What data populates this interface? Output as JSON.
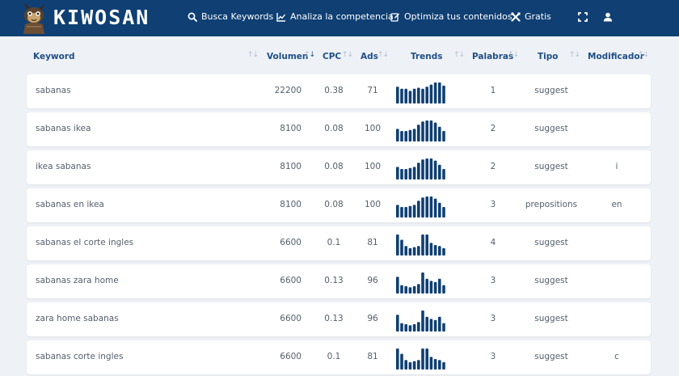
{
  "brand": "KIWOSAN",
  "nav": [
    {
      "label": "Busca Keywords",
      "icon": "search-icon"
    },
    {
      "label": "Analiza la competencia",
      "icon": "chart-line-icon"
    },
    {
      "label": "Optimiza tus contenidos",
      "icon": "edit-icon"
    },
    {
      "label": "Gratis",
      "icon": "tools-icon"
    }
  ],
  "columns": [
    "Keyword",
    "Volumen",
    "CPC",
    "Ads",
    "Trends",
    "Palabras",
    "Tipo",
    "Modificador"
  ],
  "sorted_column": "Volumen",
  "colors": {
    "topbar": "#0f3f73",
    "accent": "#1e4f86",
    "bars": "#0f3f73",
    "background": "#eef1f6"
  },
  "rows": [
    {
      "keyword": "sabanas",
      "volumen": "22200",
      "cpc": "0.38",
      "ads": "71",
      "palabras": "1",
      "tipo": "suggest",
      "modificador": "",
      "trend": [
        0.8,
        0.7,
        0.7,
        0.6,
        0.7,
        0.75,
        0.7,
        0.8,
        0.9,
        1.0,
        1.0,
        0.85
      ]
    },
    {
      "keyword": "sabanas ikea",
      "volumen": "8100",
      "cpc": "0.08",
      "ads": "100",
      "palabras": "2",
      "tipo": "suggest",
      "modificador": "",
      "trend": [
        0.6,
        0.5,
        0.5,
        0.55,
        0.6,
        0.8,
        0.95,
        1.0,
        1.0,
        0.9,
        0.7,
        0.5
      ]
    },
    {
      "keyword": "ikea sabanas",
      "volumen": "8100",
      "cpc": "0.08",
      "ads": "100",
      "palabras": "2",
      "tipo": "suggest",
      "modificador": "i",
      "trend": [
        0.6,
        0.5,
        0.5,
        0.55,
        0.6,
        0.8,
        0.95,
        1.0,
        1.0,
        0.9,
        0.7,
        0.5
      ]
    },
    {
      "keyword": "sabanas en ikea",
      "volumen": "8100",
      "cpc": "0.08",
      "ads": "100",
      "palabras": "3",
      "tipo": "prepositions",
      "modificador": "en",
      "trend": [
        0.6,
        0.5,
        0.5,
        0.55,
        0.6,
        0.8,
        0.95,
        1.0,
        1.0,
        0.9,
        0.7,
        0.5
      ]
    },
    {
      "keyword": "sabanas el corte ingles",
      "volumen": "6600",
      "cpc": "0.1",
      "ads": "81",
      "palabras": "4",
      "tipo": "suggest",
      "modificador": "",
      "trend": [
        1.0,
        0.75,
        0.45,
        0.35,
        0.4,
        0.45,
        1.0,
        1.0,
        0.6,
        0.5,
        0.45,
        0.35
      ]
    },
    {
      "keyword": "sabanas zara home",
      "volumen": "6600",
      "cpc": "0.13",
      "ads": "96",
      "palabras": "3",
      "tipo": "suggest",
      "modificador": "",
      "trend": [
        0.8,
        0.4,
        0.35,
        0.3,
        0.35,
        0.45,
        1.0,
        0.7,
        0.6,
        0.55,
        0.7,
        0.4
      ]
    },
    {
      "keyword": "zara home sabanas",
      "volumen": "6600",
      "cpc": "0.13",
      "ads": "96",
      "palabras": "3",
      "tipo": "suggest",
      "modificador": "",
      "trend": [
        0.8,
        0.4,
        0.35,
        0.3,
        0.35,
        0.45,
        1.0,
        0.7,
        0.6,
        0.55,
        0.7,
        0.4
      ]
    },
    {
      "keyword": "sabanas corte ingles",
      "volumen": "6600",
      "cpc": "0.1",
      "ads": "81",
      "palabras": "3",
      "tipo": "suggest",
      "modificador": "c",
      "trend": [
        1.0,
        0.75,
        0.45,
        0.35,
        0.4,
        0.45,
        1.0,
        1.0,
        0.6,
        0.5,
        0.45,
        0.35
      ]
    }
  ]
}
